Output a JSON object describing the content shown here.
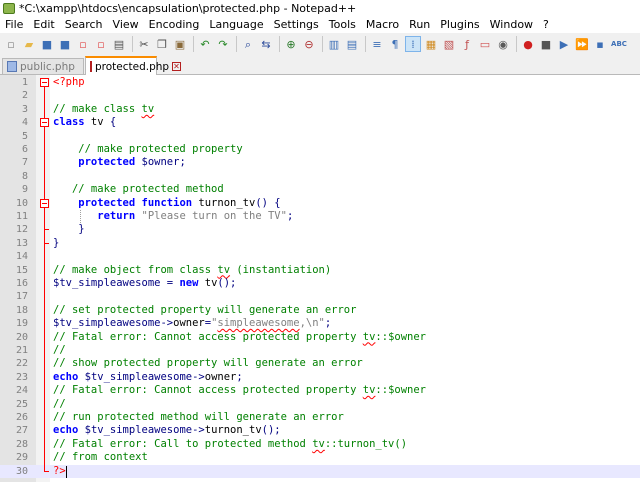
{
  "window": {
    "title": "*C:\\xampp\\htdocs\\encapsulation\\protected.php - Notepad++"
  },
  "menu": [
    "File",
    "Edit",
    "Search",
    "View",
    "Encoding",
    "Language",
    "Settings",
    "Tools",
    "Macro",
    "Run",
    "Plugins",
    "Window",
    "?"
  ],
  "toolbar": [
    {
      "name": "new-file-icon",
      "glyph": "▫",
      "color": "#ffffff"
    },
    {
      "name": "open-file-icon",
      "glyph": "▰",
      "color": "#e6b84a"
    },
    {
      "name": "save-icon",
      "glyph": "■",
      "color": "#3d6fb6"
    },
    {
      "name": "save-all-icon",
      "glyph": "■",
      "color": "#3d6fb6"
    },
    {
      "name": "close-icon",
      "glyph": "▫",
      "color": "#e05050"
    },
    {
      "name": "close-all-icon",
      "glyph": "▫",
      "color": "#e05050"
    },
    {
      "name": "print-icon",
      "glyph": "▤",
      "color": "#555555"
    },
    {
      "sep": true
    },
    {
      "name": "cut-icon",
      "glyph": "✂",
      "color": "#444444"
    },
    {
      "name": "copy-icon",
      "glyph": "❐",
      "color": "#555555"
    },
    {
      "name": "paste-icon",
      "glyph": "▣",
      "color": "#8a6a3a"
    },
    {
      "sep": true
    },
    {
      "name": "undo-icon",
      "glyph": "↶",
      "color": "#2a8a2a"
    },
    {
      "name": "redo-icon",
      "glyph": "↷",
      "color": "#2a8a2a"
    },
    {
      "sep": true
    },
    {
      "name": "find-icon",
      "glyph": "⌕",
      "color": "#2a4a9a"
    },
    {
      "name": "replace-icon",
      "glyph": "⇆",
      "color": "#2a4a9a"
    },
    {
      "sep": true
    },
    {
      "name": "zoom-in-icon",
      "glyph": "⊕",
      "color": "#2a7a2a"
    },
    {
      "name": "zoom-out-icon",
      "glyph": "⊖",
      "color": "#b03030"
    },
    {
      "sep": true
    },
    {
      "name": "sync-vertical-icon",
      "glyph": "▥",
      "color": "#3d6fb6"
    },
    {
      "name": "sync-horizontal-icon",
      "glyph": "▤",
      "color": "#3d6fb6"
    },
    {
      "sep": true
    },
    {
      "name": "word-wrap-icon",
      "glyph": "≡",
      "color": "#3d6fb6"
    },
    {
      "name": "all-chars-icon",
      "glyph": "¶",
      "color": "#3d6fb6"
    },
    {
      "name": "indent-guide-icon",
      "glyph": "⁞",
      "color": "#3d6fb6",
      "active": true
    },
    {
      "name": "define-language-icon",
      "glyph": "▦",
      "color": "#d08a20"
    },
    {
      "name": "doc-map-icon",
      "glyph": "▧",
      "color": "#c05050"
    },
    {
      "name": "function-list-icon",
      "glyph": "ƒ",
      "color": "#c05050"
    },
    {
      "name": "folder-workspace-icon",
      "glyph": "▭",
      "color": "#d05050"
    },
    {
      "name": "monitoring-icon",
      "glyph": "◉",
      "color": "#5a5a5a"
    },
    {
      "sep": true
    },
    {
      "name": "record-macro-icon",
      "glyph": "●",
      "color": "#d02020"
    },
    {
      "name": "stop-record-icon",
      "glyph": "■",
      "color": "#555555"
    },
    {
      "name": "play-macro-icon",
      "glyph": "▶",
      "color": "#3d6fb6"
    },
    {
      "name": "run-macro-multiple-icon",
      "glyph": "⏩",
      "color": "#3d6fb6"
    },
    {
      "name": "save-macro-icon",
      "glyph": "▪",
      "color": "#3d6fb6"
    },
    {
      "name": "spell-check-icon",
      "glyph": "ABC",
      "color": "#3d6fb6"
    }
  ],
  "tabs": [
    {
      "label": "public.php",
      "active": false
    },
    {
      "label": "protected.php",
      "active": true
    }
  ],
  "code_lines": [
    [
      [
        "php",
        "<?php"
      ]
    ],
    [],
    [
      [
        "cmt",
        "// make class "
      ],
      [
        "cmt-spell",
        "tv"
      ]
    ],
    [
      [
        "kw",
        "class"
      ],
      [
        "plain",
        " tv "
      ],
      [
        "op",
        "{"
      ]
    ],
    [],
    [
      [
        "cmt",
        "    // make protected property"
      ]
    ],
    [
      [
        "kw",
        "    protected"
      ],
      [
        "plain",
        " "
      ],
      [
        "var",
        "$owner"
      ],
      [
        "op",
        ";"
      ]
    ],
    [],
    [
      [
        "cmt",
        "   // make protected method"
      ]
    ],
    [
      [
        "kw",
        "    protected"
      ],
      [
        "plain",
        " "
      ],
      [
        "kw",
        "function"
      ],
      [
        "plain",
        " turnon_tv"
      ],
      [
        "op",
        "() {"
      ]
    ],
    [
      [
        "plain",
        "       "
      ],
      [
        "kw",
        "return"
      ],
      [
        "plain",
        " "
      ],
      [
        "str",
        "\"Please turn on the TV\""
      ],
      [
        "op",
        ";"
      ]
    ],
    [
      [
        "op",
        "    }"
      ]
    ],
    [
      [
        "op",
        "}"
      ]
    ],
    [],
    [
      [
        "cmt",
        "// make object from class "
      ],
      [
        "cmt-spell",
        "tv"
      ],
      [
        "cmt",
        " (instantiation)"
      ]
    ],
    [
      [
        "var",
        "$tv_simpleawesome"
      ],
      [
        "plain",
        " "
      ],
      [
        "op",
        "="
      ],
      [
        "plain",
        " "
      ],
      [
        "kw",
        "new"
      ],
      [
        "plain",
        " tv"
      ],
      [
        "op",
        "();"
      ]
    ],
    [],
    [
      [
        "cmt",
        "// set protected property will generate an error"
      ]
    ],
    [
      [
        "var",
        "$tv_simpleawesome"
      ],
      [
        "op",
        "->"
      ],
      [
        "plain",
        "owner"
      ],
      [
        "op",
        "="
      ],
      [
        "str",
        "\""
      ],
      [
        "str-spell",
        "simpleawesome"
      ],
      [
        "str",
        ",\\n\""
      ],
      [
        "op",
        ";"
      ]
    ],
    [
      [
        "cmt",
        "// Fatal error: Cannot access protected property "
      ],
      [
        "cmt-spell",
        "tv"
      ],
      [
        "cmt",
        "::$owner"
      ]
    ],
    [
      [
        "cmt",
        "//"
      ]
    ],
    [
      [
        "cmt",
        "// show protected property will generate an error"
      ]
    ],
    [
      [
        "kw",
        "echo"
      ],
      [
        "plain",
        " "
      ],
      [
        "var",
        "$tv_simpleawesome"
      ],
      [
        "op",
        "->"
      ],
      [
        "plain",
        "owner"
      ],
      [
        "op",
        ";"
      ]
    ],
    [
      [
        "cmt",
        "// Fatal error: Cannot access protected property "
      ],
      [
        "cmt-spell",
        "tv"
      ],
      [
        "cmt",
        "::$owner"
      ]
    ],
    [
      [
        "cmt",
        "//"
      ]
    ],
    [
      [
        "cmt",
        "// run protected method will generate an error"
      ]
    ],
    [
      [
        "kw",
        "echo"
      ],
      [
        "plain",
        " "
      ],
      [
        "var",
        "$tv_simpleawesome"
      ],
      [
        "op",
        "->"
      ],
      [
        "plain",
        "turnon_tv"
      ],
      [
        "op",
        "();"
      ]
    ],
    [
      [
        "cmt",
        "// Fatal error: Call to protected method "
      ],
      [
        "cmt-spell",
        "tv"
      ],
      [
        "cmt",
        "::turnon_tv()"
      ]
    ],
    [
      [
        "cmt",
        "// from context"
      ]
    ],
    [
      [
        "php",
        "?>"
      ]
    ]
  ],
  "current_line": 30
}
